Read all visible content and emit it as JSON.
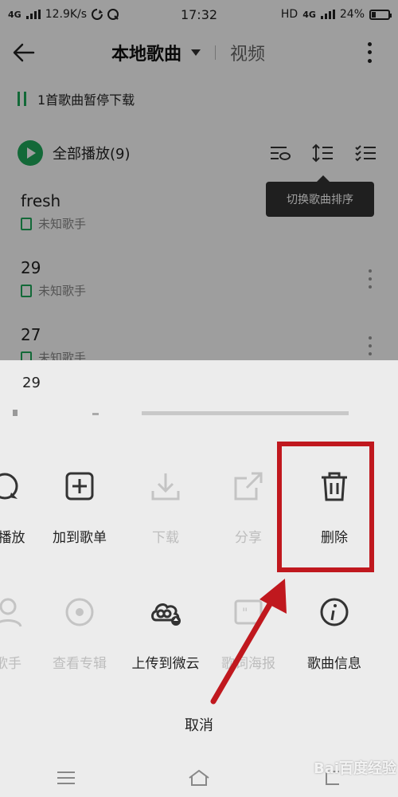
{
  "status_bar": {
    "network": "4G",
    "speed": "12.9K/s",
    "time": "17:32",
    "hd": "HD",
    "net_right": "4G",
    "battery": "24%",
    "battery_level": 0.24
  },
  "header": {
    "title": "本地歌曲",
    "tab_video": "视频"
  },
  "paused_notice": "1首歌曲暂停下载",
  "play_all": "全部播放(9)",
  "tooltip": "切换歌曲排序",
  "songs": [
    {
      "name": "fresh",
      "artist": "未知歌手"
    },
    {
      "name": "29",
      "artist": "未知歌手"
    },
    {
      "name": "27",
      "artist": "未知歌手"
    }
  ],
  "sheet": {
    "title": "29",
    "row1": [
      {
        "label": "下一首播放",
        "visible": "首播放",
        "icon": "next-play-icon",
        "dim": false
      },
      {
        "label": "加到歌单",
        "icon": "add-to-playlist-icon",
        "dim": false
      },
      {
        "label": "下载",
        "icon": "download-icon",
        "dim": true
      },
      {
        "label": "分享",
        "icon": "share-icon",
        "dim": true
      },
      {
        "label": "删除",
        "icon": "trash-icon",
        "dim": false
      }
    ],
    "row2": [
      {
        "label": "歌手",
        "icon": "singer-icon",
        "dim": true
      },
      {
        "label": "查看专辑",
        "icon": "album-icon",
        "dim": true
      },
      {
        "label": "上传到微云",
        "icon": "cloud-upload-icon",
        "dim": false
      },
      {
        "label": "歌词海报",
        "icon": "lyrics-poster-icon",
        "dim": true
      },
      {
        "label": "歌曲信息",
        "icon": "info-icon",
        "dim": false
      }
    ],
    "cancel": "取消"
  },
  "watermark": "Bai百度经验",
  "colors": {
    "accent": "#1faa5b",
    "annotation": "#c0181e"
  }
}
